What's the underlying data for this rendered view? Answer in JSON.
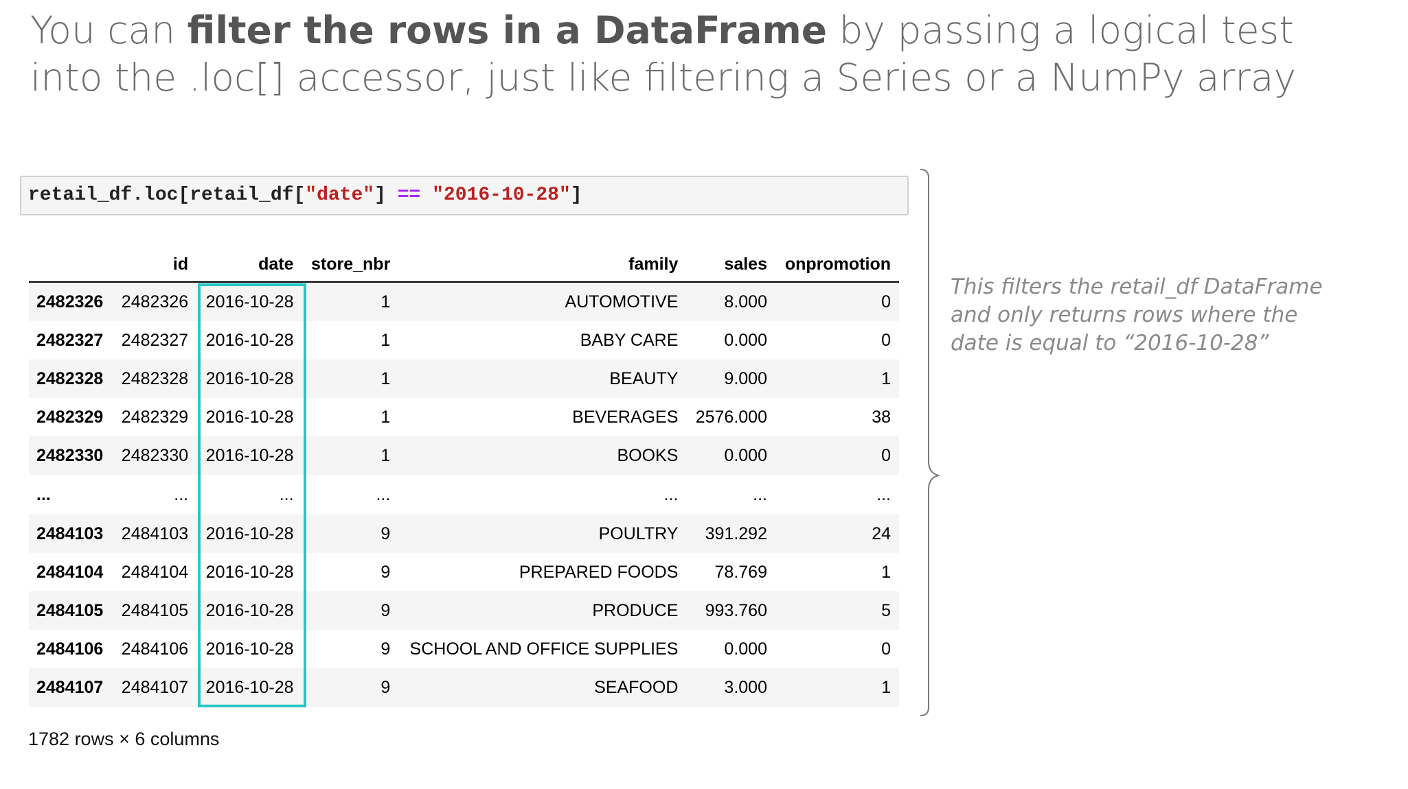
{
  "slide": {
    "title_parts": [
      "You can ",
      "filter the rows in a DataFrame",
      " by passing a logical test into the .loc[] accessor, just like filtering a Series or a NumPy array"
    ],
    "annotation": "This filters the retail_df DataFrame and only returns rows where the date is equal to “2016-10-28”"
  },
  "code": {
    "part1": "retail_df.loc[retail_df[",
    "str1": "\"date\"",
    "part2": "] ",
    "op": "==",
    "part3": " ",
    "str2": "\"2016-10-28\"",
    "part4": "]"
  },
  "table": {
    "columns": [
      "",
      "id",
      "date",
      "store_nbr",
      "family",
      "sales",
      "onpromotion"
    ],
    "rows": [
      [
        "2482326",
        "2482326",
        "2016-10-28",
        "1",
        "AUTOMOTIVE",
        "8.000",
        "0"
      ],
      [
        "2482327",
        "2482327",
        "2016-10-28",
        "1",
        "BABY CARE",
        "0.000",
        "0"
      ],
      [
        "2482328",
        "2482328",
        "2016-10-28",
        "1",
        "BEAUTY",
        "9.000",
        "1"
      ],
      [
        "2482329",
        "2482329",
        "2016-10-28",
        "1",
        "BEVERAGES",
        "2576.000",
        "38"
      ],
      [
        "2482330",
        "2482330",
        "2016-10-28",
        "1",
        "BOOKS",
        "0.000",
        "0"
      ],
      [
        "...",
        "...",
        "...",
        "...",
        "...",
        "...",
        "..."
      ],
      [
        "2484103",
        "2484103",
        "2016-10-28",
        "9",
        "POULTRY",
        "391.292",
        "24"
      ],
      [
        "2484104",
        "2484104",
        "2016-10-28",
        "9",
        "PREPARED FOODS",
        "78.769",
        "1"
      ],
      [
        "2484105",
        "2484105",
        "2016-10-28",
        "9",
        "PRODUCE",
        "993.760",
        "5"
      ],
      [
        "2484106",
        "2484106",
        "2016-10-28",
        "9",
        "SCHOOL AND OFFICE SUPPLIES",
        "0.000",
        "0"
      ],
      [
        "2484107",
        "2484107",
        "2016-10-28",
        "9",
        "SEAFOOD",
        "3.000",
        "1"
      ]
    ],
    "footer": "1782 rows × 6 columns"
  },
  "colors": {
    "highlight": "#28c6c6",
    "string_token": "#ba2121",
    "operator_token": "#aa22ff"
  }
}
